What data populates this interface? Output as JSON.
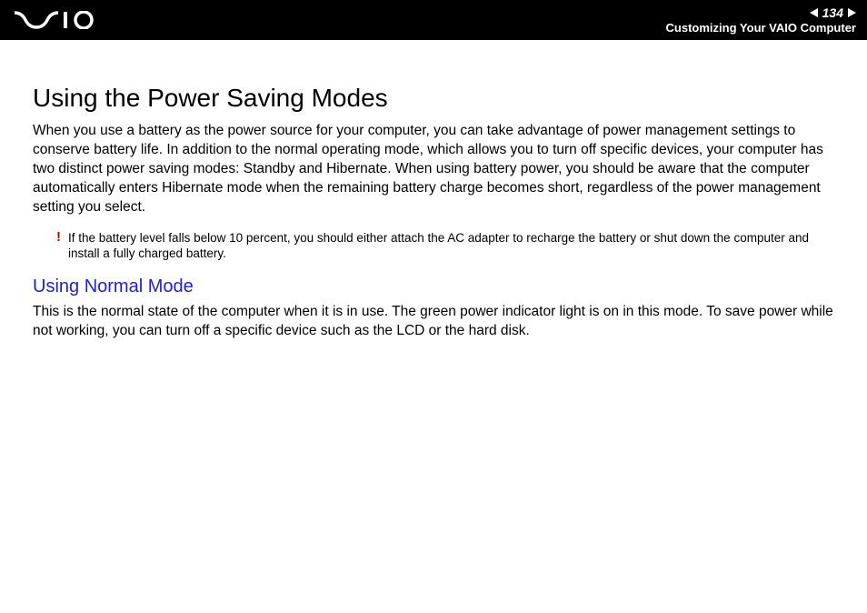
{
  "header": {
    "page_number": "134",
    "section_label": "Customizing Your VAIO Computer"
  },
  "content": {
    "title": "Using the Power Saving Modes",
    "intro": "When you use a battery as the power source for your computer, you can take advantage of power management settings to conserve battery life. In addition to the normal operating mode, which allows you to turn off specific devices, your computer has two distinct power saving modes: Standby and Hibernate. When using battery power, you should be aware that the computer automatically enters Hibernate mode when the remaining battery charge becomes short, regardless of the power management setting you select.",
    "note_mark": "!",
    "note": "If the battery level falls below 10 percent, you should either attach the AC adapter to recharge the battery or shut down the computer and install a fully charged battery.",
    "subheading": "Using Normal Mode",
    "sub_body": "This is the normal state of the computer when it is in use. The green power indicator light is on in this mode. To save power while not working, you can turn off a specific device such as the LCD or the hard disk."
  }
}
